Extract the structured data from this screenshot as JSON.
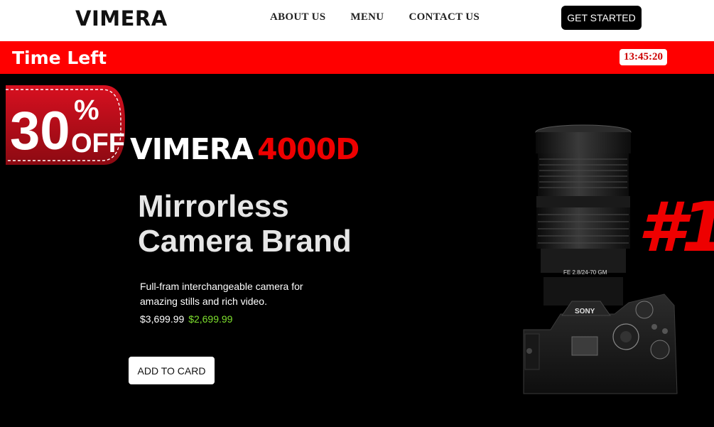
{
  "nav": {
    "logo": "VIMERA",
    "links": [
      "ABOUT US",
      "MENU",
      "CONTACT US"
    ],
    "cta": "GET STARTED"
  },
  "timer_bar": {
    "label": "Time Left",
    "time": "13:45:20"
  },
  "hero": {
    "badge": {
      "number": "30",
      "percent": "%",
      "off": "OFF"
    },
    "brand": "VIMERA",
    "model": "4000D",
    "headline_line1": "Mirrorless",
    "headline_line2": "Camera Brand",
    "description": "Full-fram interchangeable camera for amazing stills and rich video.",
    "old_price": "$3,699.99",
    "new_price": "$2,699.99",
    "button": "ADD TO CARD",
    "rank": "#1",
    "camera": {
      "lens_text": "FE 2.8/24-70 GM",
      "body_brand": "SONY"
    }
  },
  "colors": {
    "accent_red": "#ff0000",
    "sale_green": "#7ee02e",
    "hero_bg": "#000000"
  }
}
